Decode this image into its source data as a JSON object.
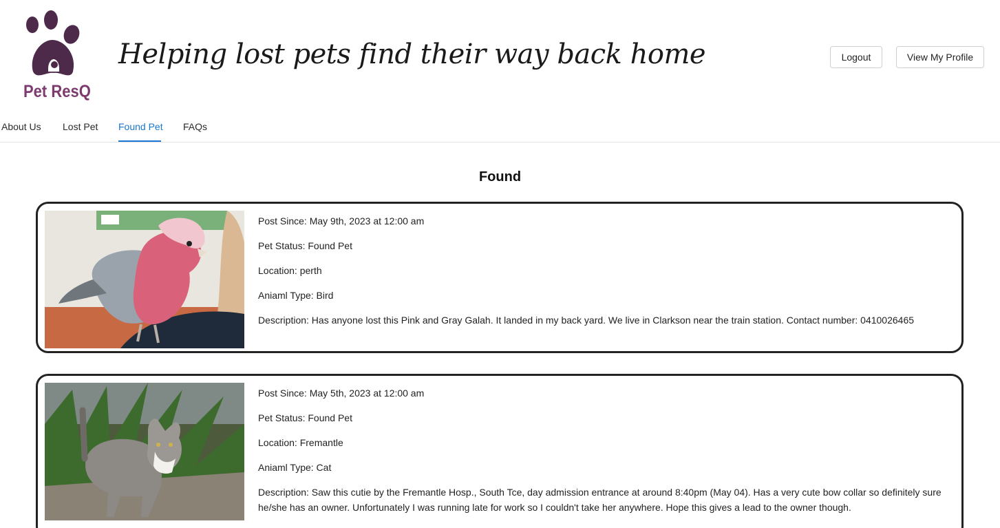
{
  "header": {
    "logo_text": "Pet ResQ",
    "tagline": "Helping lost pets find their way back home",
    "logout_label": "Logout",
    "profile_label": "View My Profile"
  },
  "nav": {
    "items": [
      {
        "label": "About Us"
      },
      {
        "label": "Lost Pet"
      },
      {
        "label": "Found Pet",
        "active": true
      },
      {
        "label": "FAQs"
      }
    ]
  },
  "main": {
    "title": "Found",
    "posts": [
      {
        "post_since": "Post Since: May 9th, 2023 at 12:00 am",
        "status": "Pet Status: Found Pet",
        "location": "Location: perth",
        "animal_type": "Aniaml Type: Bird",
        "description": "Description: Has anyone lost this Pink and Gray Galah. It landed in my back yard. We live in Clarkson near the train station. Contact number: 0410026465"
      },
      {
        "post_since": "Post Since: May 5th, 2023 at 12:00 am",
        "status": "Pet Status: Found Pet",
        "location": "Location: Fremantle",
        "animal_type": "Aniaml Type: Cat",
        "description": "Description: Saw this cutie by the Fremantle Hosp., South Tce, day admission entrance at around 8:40pm (May 04). Has a very cute bow collar so definitely sure he/she has an owner. Unfortunately I was running late for work so I couldn't take her anywhere. Hope this gives a lead to the owner though."
      }
    ]
  },
  "colors": {
    "brand": "#7d3a6d",
    "logo_dark": "#4e2a4a",
    "accent": "#1976d2",
    "card_border": "#222222"
  }
}
